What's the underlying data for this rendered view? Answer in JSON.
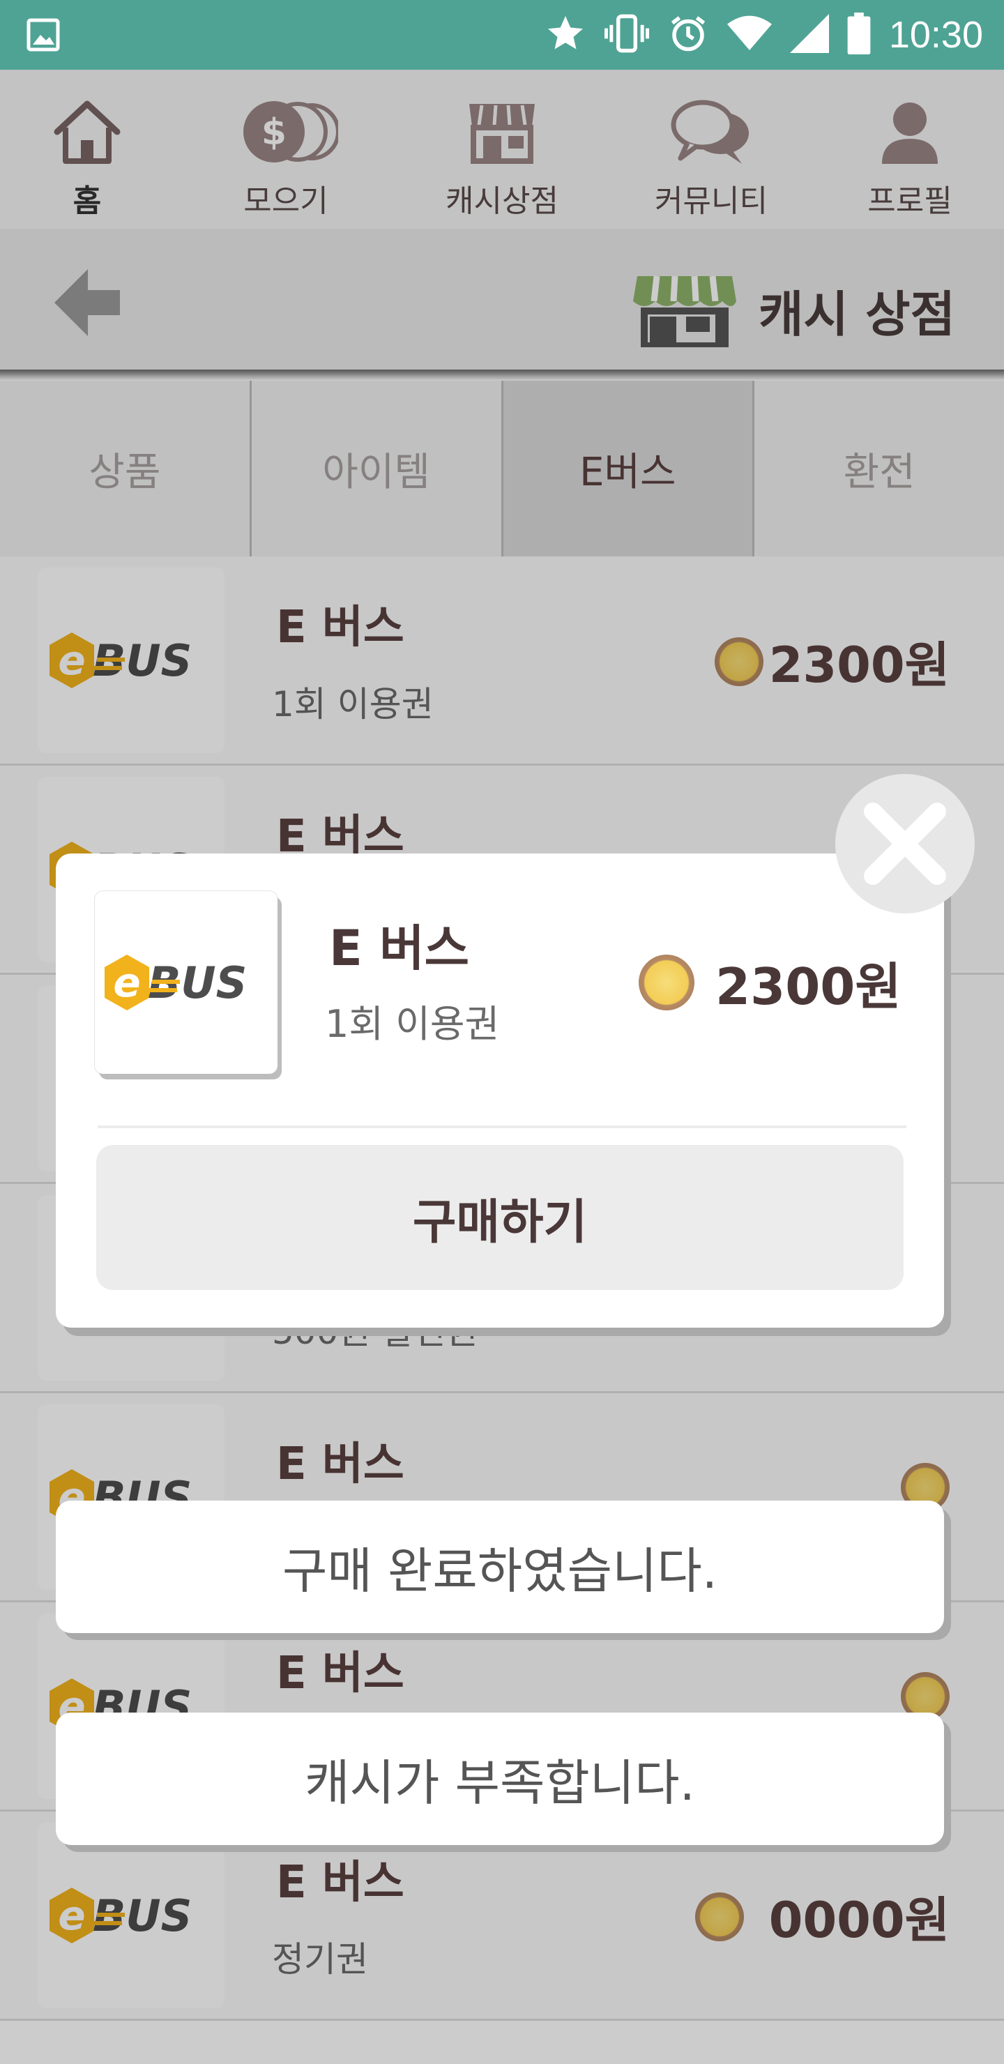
{
  "status_bar": {
    "time": "10:30",
    "icons": [
      "image-icon",
      "star-icon",
      "vibrate-icon",
      "alarm-icon",
      "wifi-icon",
      "signal-icon",
      "battery-icon"
    ]
  },
  "nav": {
    "items": [
      {
        "label": "홈",
        "icon": "home-icon",
        "active": true
      },
      {
        "label": "모으기",
        "icon": "coins-icon",
        "active": false
      },
      {
        "label": "캐시상점",
        "icon": "store-icon",
        "active": false
      },
      {
        "label": "커뮤니티",
        "icon": "chat-icon",
        "active": false
      },
      {
        "label": "프로필",
        "icon": "profile-icon",
        "active": false
      }
    ]
  },
  "header": {
    "title": "캐시 상점",
    "back_icon": "back-arrow-icon",
    "title_icon": "shop-icon"
  },
  "tabs": [
    {
      "label": "상품",
      "active": false
    },
    {
      "label": "아이템",
      "active": false
    },
    {
      "label": "E버스",
      "active": true
    },
    {
      "label": "환전",
      "active": false
    }
  ],
  "list": [
    {
      "title": "E 버스",
      "sub": "1회 이용권",
      "price": "2300원"
    },
    {
      "title": "E 버스",
      "sub": "",
      "price": ""
    },
    {
      "title": "",
      "sub": "",
      "price": ""
    },
    {
      "title": "",
      "sub": "500원 할인권",
      "price": ""
    },
    {
      "title": "E 버스",
      "sub": "",
      "price": ""
    },
    {
      "title": "E 버스",
      "sub": "",
      "price": ""
    },
    {
      "title": "E 버스",
      "sub": "정기권",
      "price": "0000원"
    }
  ],
  "modal": {
    "title": "E 버스",
    "sub": "1회 이용권",
    "price": "2300원",
    "buy_label": "구매하기"
  },
  "toasts": {
    "purchase_done": "구매 완료하였습니다.",
    "insufficient_cash": "캐시가 부족합니다."
  },
  "logo": {
    "text": "eBUS"
  },
  "colors": {
    "status_bar": "#4fa394",
    "text_brown": "#5a4040",
    "coin_gold": "#f3cd56",
    "logo_yellow": "#f2b21c",
    "logo_gray": "#4d4d4d"
  }
}
